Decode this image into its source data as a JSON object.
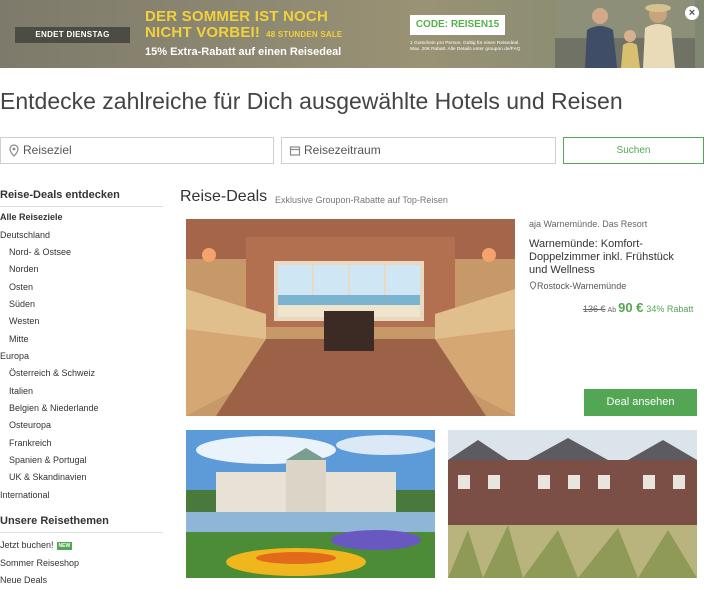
{
  "banner": {
    "tag": "ENDET DIENSTAG",
    "title_line1": "DER SOMMER IST  NOCH",
    "title_line2": "NICHT VORBEI!",
    "sale": "48 STUNDEN SALE",
    "subtitle": "15% Extra-Rabatt auf einen Reisedeal",
    "code": "CODE: REISEN15",
    "fine_line1": "1 Gutschein pro Person. Gültig für einen Reisedeal.",
    "fine_line2": "Max. 20€ Rabatt. Alle Details unter groupon.de/FAQ",
    "close_icon": "close-icon"
  },
  "heading": "Entdecke zahlreiche für Dich ausgewählte Hotels und Reisen",
  "search": {
    "destination_placeholder": "Reiseziel",
    "period_placeholder": "Reisezeitraum",
    "button": "Suchen"
  },
  "sidebar": {
    "deals_heading": "Reise-Deals entdecken",
    "items": [
      {
        "label": "Alle Reiseziele"
      },
      {
        "label": "Deutschland"
      },
      {
        "label": "Nord- & Ostsee"
      },
      {
        "label": "Norden"
      },
      {
        "label": "Osten"
      },
      {
        "label": "Süden"
      },
      {
        "label": "Westen"
      },
      {
        "label": "Mitte"
      },
      {
        "label": "Europa"
      },
      {
        "label": "Österreich & Schweiz"
      },
      {
        "label": "Italien"
      },
      {
        "label": "Belgien & Niederlande"
      },
      {
        "label": "Osteuropa"
      },
      {
        "label": "Frankreich"
      },
      {
        "label": "Spanien & Portugal"
      },
      {
        "label": "UK & Skandinavien"
      },
      {
        "label": "International"
      }
    ],
    "themes_heading": "Unsere Reisethemen",
    "themes": [
      {
        "label": "Jetzt buchen!"
      },
      {
        "label": "Sommer Reiseshop"
      },
      {
        "label": "Neue Deals"
      }
    ],
    "new_badge": "NEW"
  },
  "main": {
    "title": "Reise-Deals",
    "subtitle": "Exklusive Groupon-Rabatte auf Top-Reisen",
    "deal": {
      "merchant": "aja Warnemünde. Das Resort",
      "title": "Warnemünde: Komfort-Doppelzimmer inkl. Frühstück und Wellness",
      "location": "Rostock-Warnemünde",
      "old_price": "136 €",
      "ab": "Ab",
      "new_price": "90 €",
      "discount": "34% Rabatt",
      "button": "Deal ansehen"
    }
  },
  "colors": {
    "accent": "#53a653",
    "banner_yellow": "#f2d23c"
  }
}
